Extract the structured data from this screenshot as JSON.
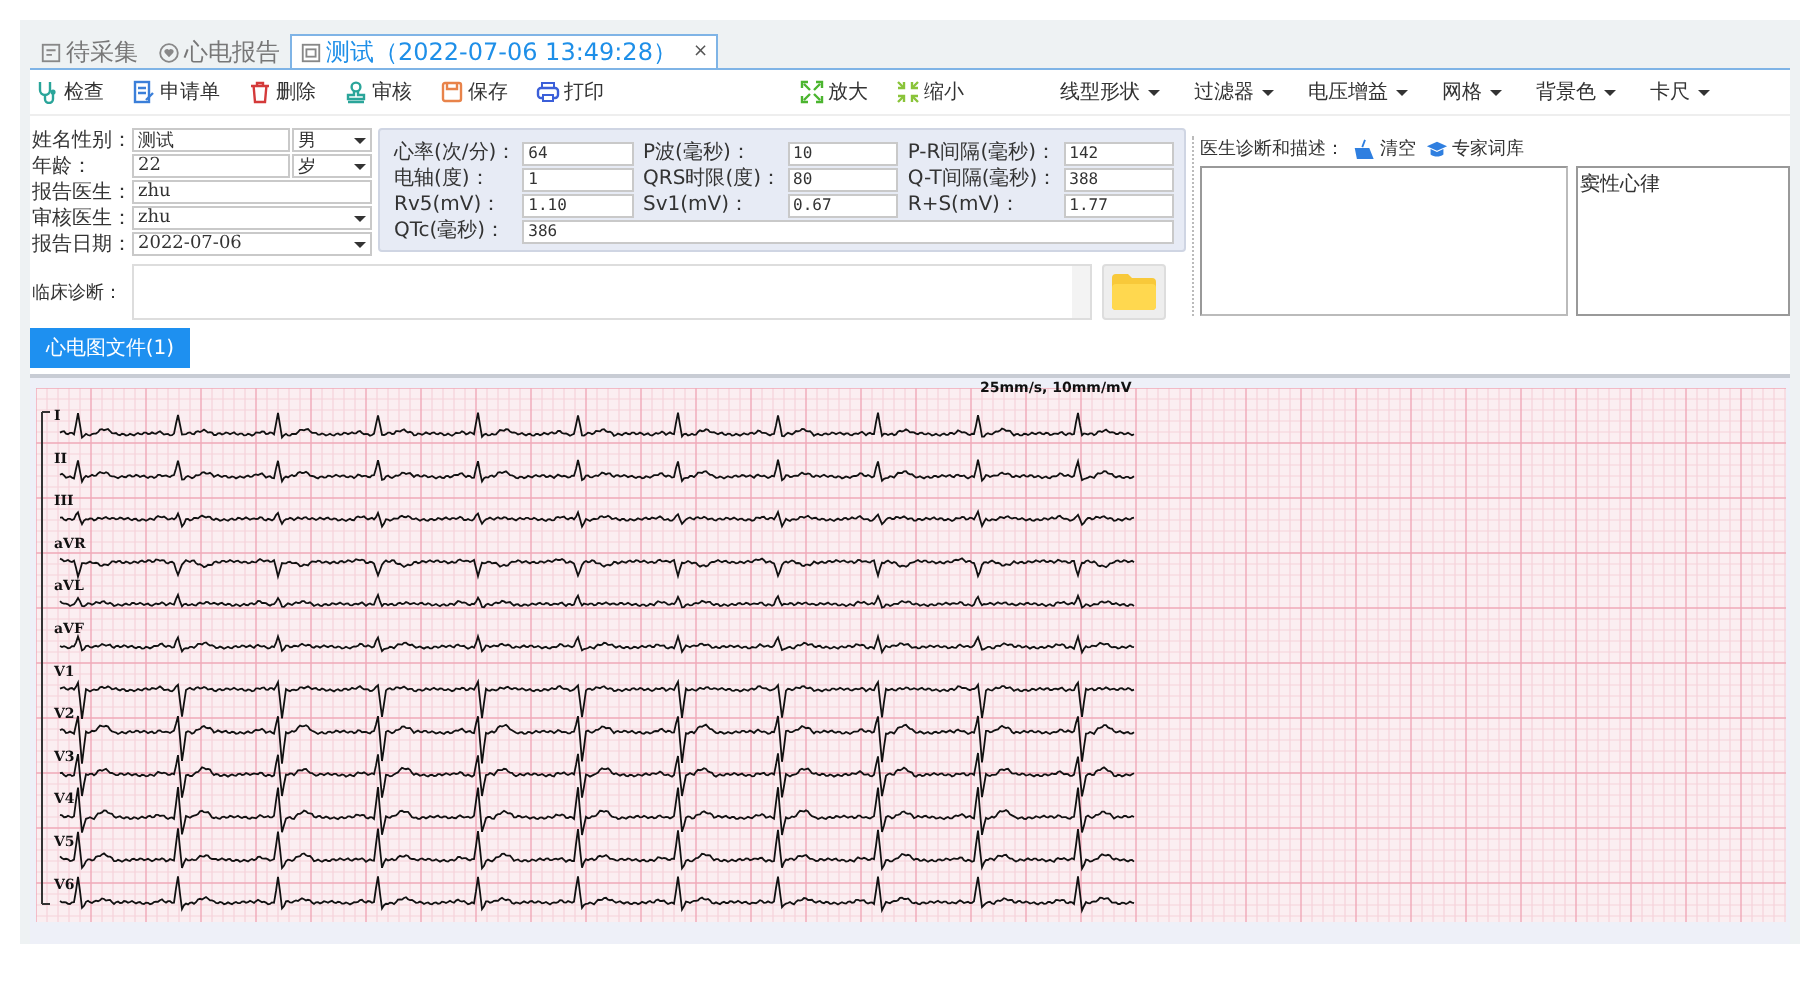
{
  "tabs": [
    {
      "label": "待采集",
      "kind": "form",
      "selected": false
    },
    {
      "label": "心电报告",
      "kind": "heart",
      "selected": false
    },
    {
      "label": "测试（2022-07-06 13:49:28）",
      "kind": "doc",
      "selected": true,
      "close": "×"
    }
  ],
  "toolbar": {
    "actions": [
      {
        "label": "检查",
        "kind": "stethoscope"
      },
      {
        "label": "申请单",
        "kind": "request"
      },
      {
        "label": "删除",
        "kind": "delete"
      },
      {
        "label": "审核",
        "kind": "audit"
      },
      {
        "label": "保存",
        "kind": "save"
      },
      {
        "label": "打印",
        "kind": "print"
      }
    ],
    "zoom": [
      {
        "label": "放大",
        "kind": "zoom-in"
      },
      {
        "label": "缩小",
        "kind": "zoom-out"
      }
    ],
    "menus": [
      "线型形状",
      "过滤器",
      "电压增益",
      "网格",
      "背景色",
      "卡尺"
    ]
  },
  "patient": [
    {
      "kind": "text-select",
      "label": "姓名性别：",
      "value": "测试",
      "option": "男"
    },
    {
      "kind": "text-select",
      "label": "年龄：",
      "value": "22",
      "option": "岁"
    },
    {
      "kind": "text",
      "label": "报告医生：",
      "value": "zhu"
    },
    {
      "kind": "dropdown",
      "label": "审核医生：",
      "value": "zhu"
    },
    {
      "kind": "dropdown",
      "label": "报告日期：",
      "value": "2022-07-06"
    }
  ],
  "measurements": [
    {
      "label": "心率(次/分)：",
      "value": "64"
    },
    {
      "label": "P波(毫秒)：",
      "value": "10"
    },
    {
      "label": "P-R间隔(毫秒)：",
      "value": "142"
    },
    {
      "label": "电轴(度)：",
      "value": "1"
    },
    {
      "label": "QRS时限(度)：",
      "value": "80"
    },
    {
      "label": "Q-T间隔(毫秒)：",
      "value": "388"
    },
    {
      "label": "Rv5(mV)：",
      "value": "1.10"
    },
    {
      "label": "Sv1(mV)：",
      "value": "0.67"
    },
    {
      "label": "R+S(mV)：",
      "value": "1.77"
    },
    {
      "label": "QTc(毫秒)：",
      "value": "386"
    }
  ],
  "clinical": {
    "label": "临床诊断："
  },
  "diagnosis": {
    "label": "医生诊断和描述：",
    "actions": [
      {
        "label": "清空",
        "kind": "broom"
      },
      {
        "label": "专家词库",
        "kind": "cap"
      }
    ],
    "conclusion": "窦性心律"
  },
  "ecg_files_tab": {
    "label": "心电图文件(1)",
    "selected": true
  },
  "ecg": {
    "scale": "25mm/s, 10mm/mV",
    "leads": [
      "I",
      "II",
      "III",
      "aVR",
      "aVL",
      "aVF",
      "V1",
      "V2",
      "V3",
      "V4",
      "V5",
      "V6"
    ]
  }
}
